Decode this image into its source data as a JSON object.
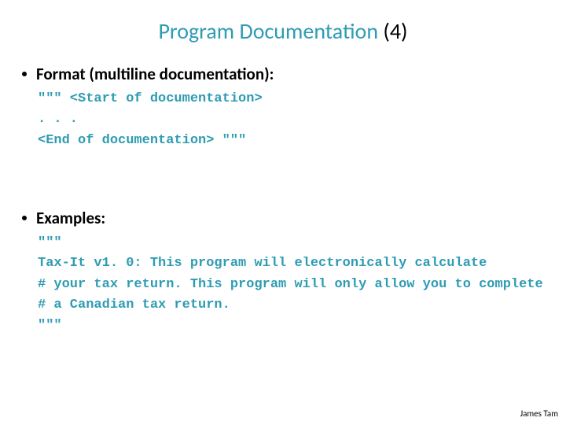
{
  "title": {
    "main": "Program Documentation ",
    "paren": "(4)"
  },
  "section1": {
    "heading": "Format (multiline documentation):",
    "code": "\"\"\" <Start of documentation>\n. . .\n<End of documentation> \"\"\""
  },
  "section2": {
    "heading": "Examples:",
    "code": "\"\"\"\nTax-It v1. 0: This program will electronically calculate\n# your tax return. This program will only allow you to complete\n# a Canadian tax return.\n\"\"\""
  },
  "footer": "James Tam"
}
